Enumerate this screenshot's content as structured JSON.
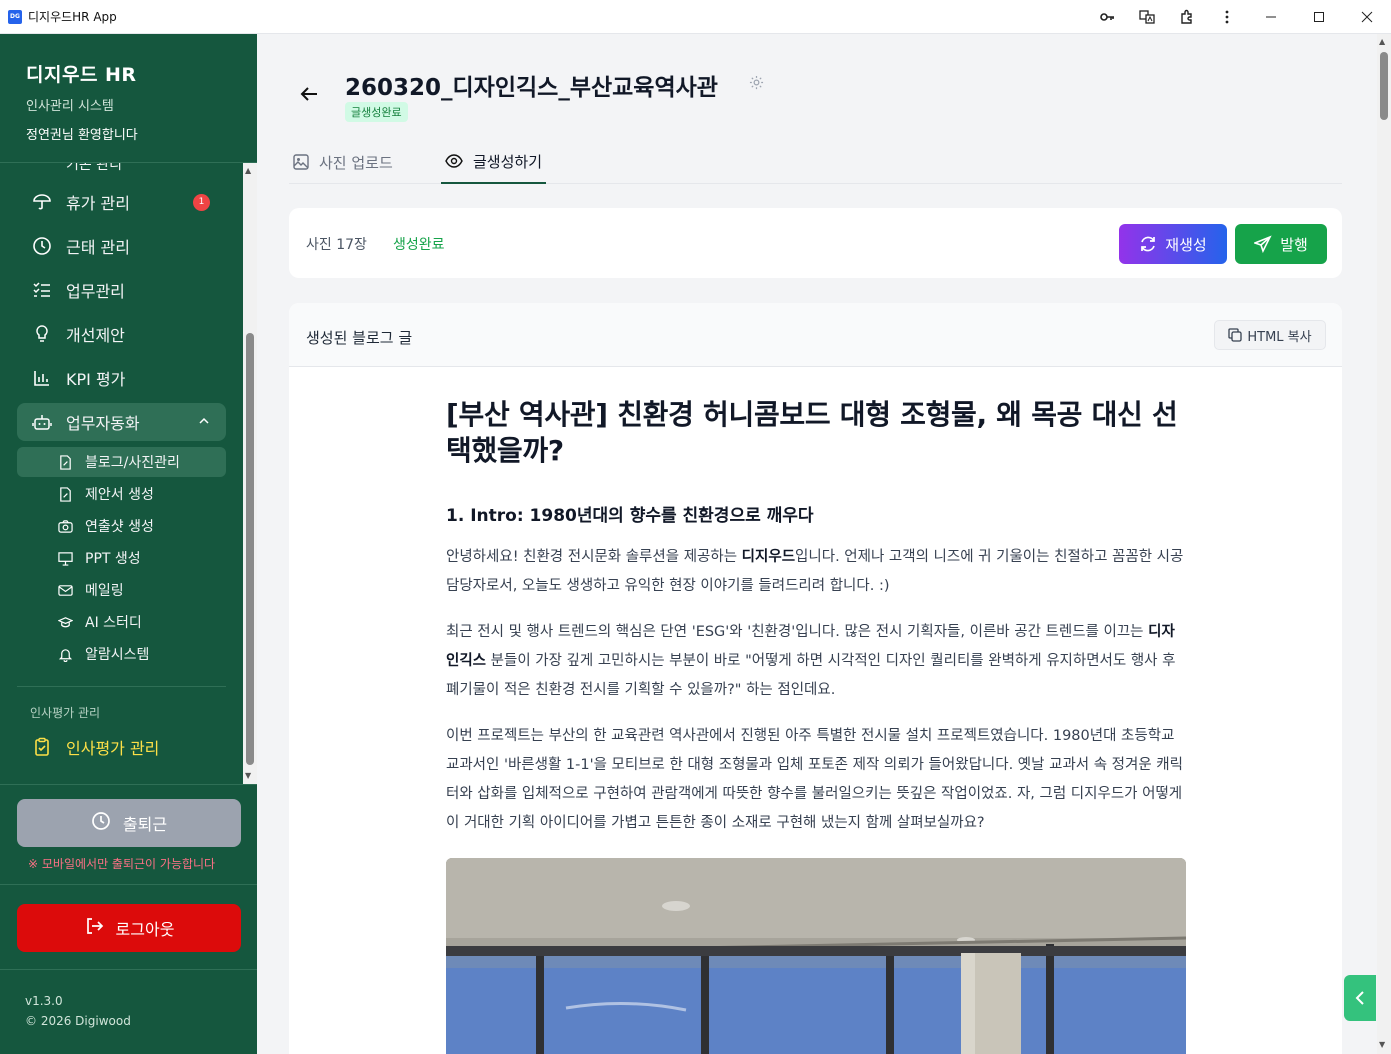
{
  "window": {
    "app_icon_text": "DG",
    "title": "디지우드HR App"
  },
  "sidebar": {
    "brand_title": "디지우드 HR",
    "brand_subtitle": "인사관리 시스템",
    "welcome": "정연권님 환영합니다",
    "cut_item": "기본 관리",
    "items": [
      {
        "label": "휴가 관리",
        "icon": "umbrella-icon",
        "badge": "1"
      },
      {
        "label": "근태 관리",
        "icon": "clock-icon"
      },
      {
        "label": "업무관리",
        "icon": "checklist-icon"
      },
      {
        "label": "개선제안",
        "icon": "lightbulb-icon"
      },
      {
        "label": "KPI 평가",
        "icon": "bar-chart-icon"
      },
      {
        "label": "업무자동화",
        "icon": "robot-icon",
        "expanded": true
      }
    ],
    "sub_items": [
      {
        "label": "블로그/사진관리",
        "icon": "document-icon",
        "active": true
      },
      {
        "label": "제안서 생성",
        "icon": "document-icon"
      },
      {
        "label": "연출샷 생성",
        "icon": "camera-icon"
      },
      {
        "label": "PPT 생성",
        "icon": "presentation-icon"
      },
      {
        "label": "메일링",
        "icon": "mail-icon"
      },
      {
        "label": "AI 스터디",
        "icon": "graduation-cap-icon"
      },
      {
        "label": "알람시스템",
        "icon": "bell-icon"
      }
    ],
    "section_label": "인사평가 관리",
    "eval_item": "인사평가 관리",
    "clock_button": "출퇴근",
    "mobile_note": "※ 모바일에서만 출퇴근이 가능합니다",
    "logout_button": "로그아웃",
    "version": "v1.3.0",
    "copyright": "© 2026 Digiwood"
  },
  "header": {
    "title": "260320_디자인긱스_부산교육역사관",
    "status": "글생성완료"
  },
  "tabs": [
    {
      "label": "사진 업로드",
      "active": false
    },
    {
      "label": "글생성하기",
      "active": true
    }
  ],
  "summary": {
    "photo_count": "사진 17장",
    "status": "생성완료",
    "regenerate_button": "재생성",
    "publish_button": "발행"
  },
  "blog": {
    "section_title": "생성된 블로그 글",
    "copy_button": "HTML 복사",
    "title": "[부산 역사관] 친환경 허니콤보드 대형 조형물, 왜 목공 대신 선택했을까?",
    "heading1": "1. Intro: 1980년대의 향수를 친환경으로 깨우다",
    "p1_a": "안녕하세요! 친환경 전시문화 솔루션을 제공하는 ",
    "p1_b": "디지우드",
    "p1_c": "입니다. 언제나 고객의 니즈에 귀 기울이는 친절하고 꼼꼼한 시공 담당자로서, 오늘도 생생하고 유익한 현장 이야기를 들려드리려 합니다. :)",
    "p2_a": "최근 전시 및 행사 트렌드의 핵심은 단연 'ESG'와 '친환경'입니다. 많은 전시 기획자들, 이른바 공간 트렌드를 이끄는 ",
    "p2_b": "디자인긱스",
    "p2_c": " 분들이 가장 깊게 고민하시는 부분이 바로 \"어떻게 하면 시각적인 디자인 퀄리티를 완벽하게 유지하면서도 행사 후 폐기물이 적은 친환경 전시를 기획할 수 있을까?\" 하는 점인데요.",
    "p3": "이번 프로젝트는 부산의 한 교육관련 역사관에서 진행된 아주 특별한 전시물 설치 프로젝트였습니다. 1980년대 초등학교 교과서인 '바른생활 1-1'을 모티브로 한 대형 조형물과 입체 포토존 제작 의뢰가 들어왔답니다. 옛날 교과서 속 정겨운 캐릭터와 삽화를 입체적으로 구현하여 관람객에게 따뜻한 향수를 불러일으키는 뜻깊은 작업이었죠. 자, 그럼 디지우드가 어떻게 이 거대한 기획 아이디어를 가볍고 튼튼한 종이 소재로 구현해 냈는지 함께 살펴보실까요?"
  },
  "colors": {
    "sidebar_bg": "#15573e",
    "accent_green": "#16a34a",
    "logout_red": "#dc0b0b",
    "badge_red": "#ef4444"
  }
}
